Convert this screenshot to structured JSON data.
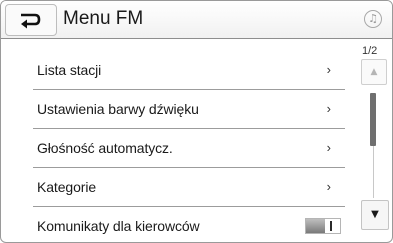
{
  "header": {
    "back_icon": "back-arrow-icon",
    "title": "Menu FM",
    "music_icon": "music-note-icon",
    "music_glyph": "♫"
  },
  "menu": {
    "items": [
      {
        "label": "Lista stacji",
        "control": "arrow",
        "arrow": "›"
      },
      {
        "label": "Ustawienia barwy dźwięku",
        "control": "arrow",
        "arrow": "›"
      },
      {
        "label": "Głośność automatycz.",
        "control": "arrow",
        "arrow": "›"
      },
      {
        "label": "Kategorie",
        "control": "arrow",
        "arrow": "›"
      },
      {
        "label": "Komunikaty dla kierowców",
        "control": "toggle",
        "toggle_state": "off"
      }
    ]
  },
  "scroll": {
    "page_indicator": "1/2",
    "up_glyph": "▲",
    "down_glyph": "▼",
    "thumb_fraction": 0.5
  }
}
